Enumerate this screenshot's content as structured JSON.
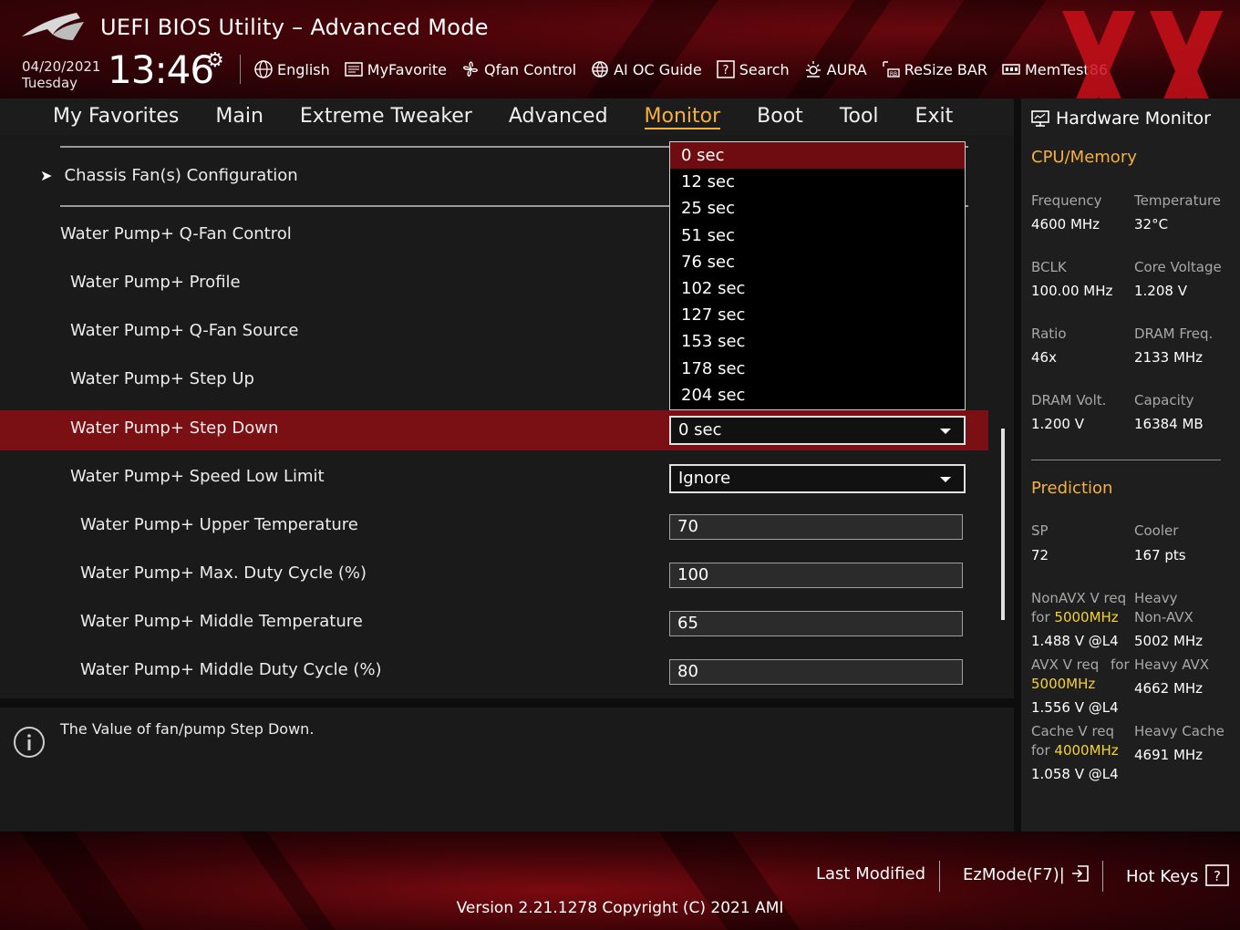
{
  "header": {
    "title": "UEFI BIOS Utility – Advanced Mode",
    "date": "04/20/2021",
    "day": "Tuesday",
    "time": "13:46",
    "toolbar": [
      {
        "label": "English",
        "icon": "globe-icon"
      },
      {
        "label": "MyFavorite",
        "icon": "favorite-list-icon"
      },
      {
        "label": "Qfan Control",
        "icon": "fan-icon"
      },
      {
        "label": "AI OC Guide",
        "icon": "ai-globe-icon"
      },
      {
        "label": "Search",
        "icon": "search-question-icon"
      },
      {
        "label": "AURA",
        "icon": "aura-light-icon"
      },
      {
        "label": "ReSize BAR",
        "icon": "resize-bar-icon"
      },
      {
        "label": "MemTest86",
        "icon": "memory-icon"
      }
    ]
  },
  "nav": {
    "tabs": [
      "My Favorites",
      "Main",
      "Extreme Tweaker",
      "Advanced",
      "Monitor",
      "Boot",
      "Tool",
      "Exit"
    ],
    "active": "Monitor"
  },
  "settings": {
    "chassis_fan": "Chassis Fan(s) Configuration",
    "rows": [
      {
        "label": "Water Pump+ Q-Fan Control"
      },
      {
        "label": "Water Pump+ Profile"
      },
      {
        "label": "Water Pump+ Q-Fan Source"
      },
      {
        "label": "Water Pump+ Step Up"
      },
      {
        "label": "Water Pump+ Step Down",
        "value": "0 sec"
      },
      {
        "label": "Water Pump+ Speed Low Limit",
        "value": "Ignore"
      },
      {
        "label": "Water Pump+ Upper Temperature",
        "value": "70"
      },
      {
        "label": "Water Pump+ Max. Duty Cycle (%)",
        "value": "100"
      },
      {
        "label": "Water Pump+ Middle Temperature",
        "value": "65"
      },
      {
        "label": "Water Pump+ Middle Duty Cycle (%)",
        "value": "80"
      }
    ],
    "dropdown_options": [
      "0 sec",
      "12 sec",
      "25 sec",
      "51 sec",
      "76 sec",
      "102 sec",
      "127 sec",
      "153 sec",
      "178 sec",
      "204 sec"
    ],
    "dropdown_selected": "0 sec"
  },
  "help": {
    "text": "The Value of fan/pump Step Down."
  },
  "hardware_monitor": {
    "title": "Hardware Monitor",
    "cpu_memory": {
      "heading": "CPU/Memory",
      "items": [
        {
          "label": "Frequency",
          "value": "4600 MHz"
        },
        {
          "label": "Temperature",
          "value": "32°C"
        },
        {
          "label": "BCLK",
          "value": "100.00 MHz"
        },
        {
          "label": "Core Voltage",
          "value": "1.208 V"
        },
        {
          "label": "Ratio",
          "value": "46x"
        },
        {
          "label": "DRAM Freq.",
          "value": "2133 MHz"
        },
        {
          "label": "DRAM Volt.",
          "value": "1.200 V"
        },
        {
          "label": "Capacity",
          "value": "16384 MB"
        }
      ]
    },
    "prediction": {
      "heading": "Prediction",
      "sp_label": "SP",
      "sp_value": "72",
      "cooler_label": "Cooler",
      "cooler_value": "167 pts",
      "nonavx_label1": "NonAVX V req",
      "nonavx_for": "for",
      "nonavx_freq": "5000MHz",
      "nonavx_value": "1.488 V @L4",
      "heavy_nonavx_label1": "Heavy",
      "heavy_nonavx_label2": "Non-AVX",
      "heavy_nonavx_value": "5002 MHz",
      "avx_label1": "AVX V req",
      "avx_for": "for",
      "avx_freq": "5000MHz",
      "avx_value": "1.556 V @L4",
      "heavy_avx_label": "Heavy AVX",
      "heavy_avx_value": "4662 MHz",
      "cache_label1": "Cache V req",
      "cache_for": "for",
      "cache_freq": "4000MHz",
      "cache_value": "1.058 V @L4",
      "heavy_cache_label": "Heavy Cache",
      "heavy_cache_value": "4691 MHz"
    }
  },
  "footer": {
    "last_modified": "Last Modified",
    "ezmode": "EzMode(F7)|",
    "hotkeys": "Hot Keys",
    "version": "Version 2.21.1278 Copyright (C) 2021 AMI"
  },
  "colors": {
    "accent": "#f5b041",
    "highlight_row": "#7a1014",
    "dropdown_selected": "#6e0c12",
    "frequency_yellow": "#f5d233"
  }
}
